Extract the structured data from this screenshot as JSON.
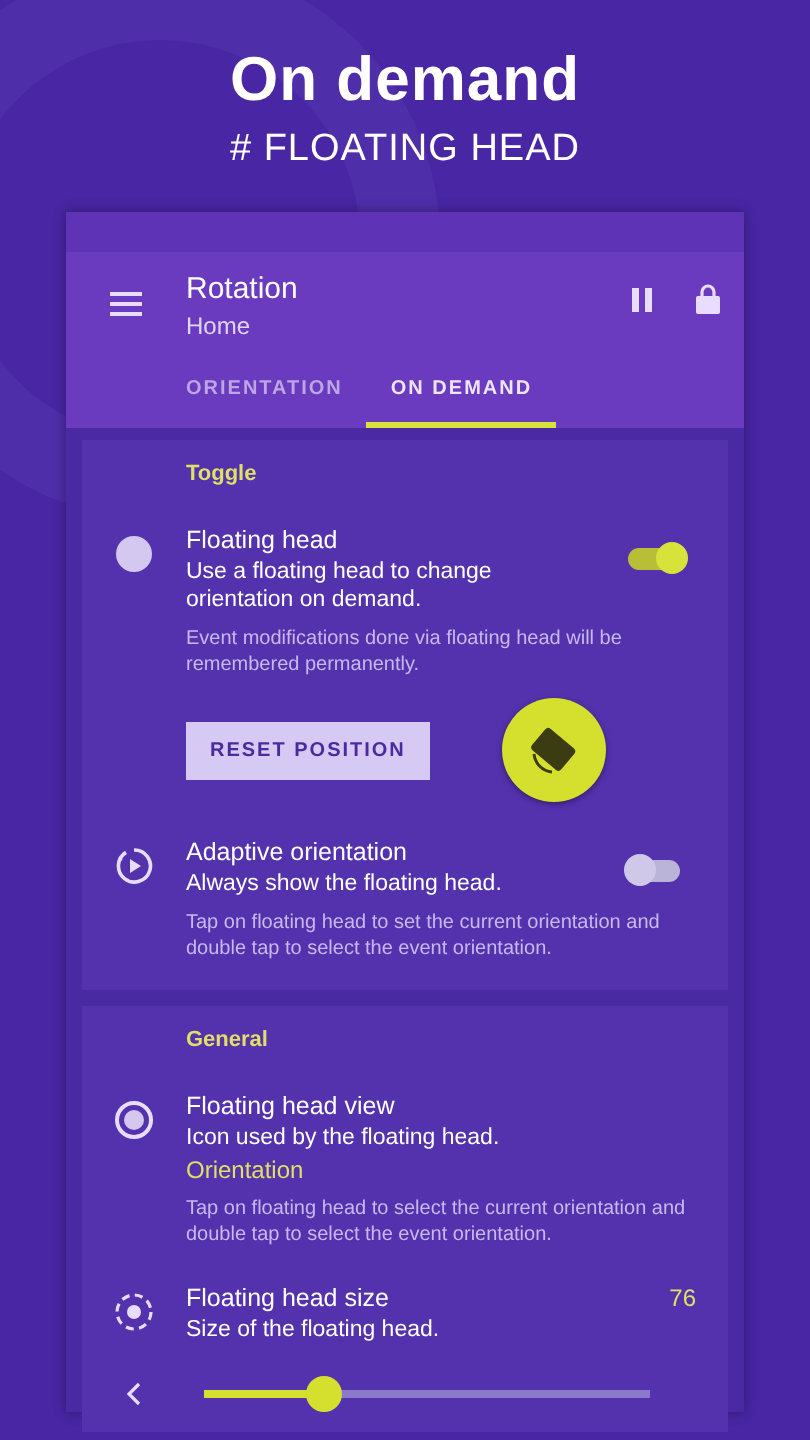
{
  "headline": {
    "title": "On demand",
    "subtitle": "# FLOATING HEAD"
  },
  "toolbar": {
    "title": "Rotation",
    "subtitle": "Home"
  },
  "tabs": [
    {
      "label": "ORIENTATION",
      "selected": false
    },
    {
      "label": "ON DEMAND",
      "selected": true
    }
  ],
  "sections": [
    {
      "header": "Toggle",
      "items": [
        {
          "kind": "switch",
          "title": "Floating head",
          "summary": "Use a floating head to change orientation on demand.",
          "note": "Event modifications done via floating head will be remembered permanently.",
          "on": true,
          "button": "RESET POSITION",
          "floating_head": true
        },
        {
          "kind": "switch",
          "title": "Adaptive orientation",
          "summary": "Always show the floating head.",
          "note": "Tap on floating head to set the current orientation and double tap to select the event orientation.",
          "on": false
        }
      ]
    },
    {
      "header": "General",
      "items": [
        {
          "kind": "choice",
          "title": "Floating head view",
          "summary": "Icon used by the floating head.",
          "value": "Orientation",
          "note": "Tap on floating head to select the current orientation and double tap to select the event orientation."
        },
        {
          "kind": "slider",
          "title": "Floating head size",
          "summary": "Size of the floating head.",
          "reading": "76",
          "level": 0.25
        }
      ]
    }
  ]
}
